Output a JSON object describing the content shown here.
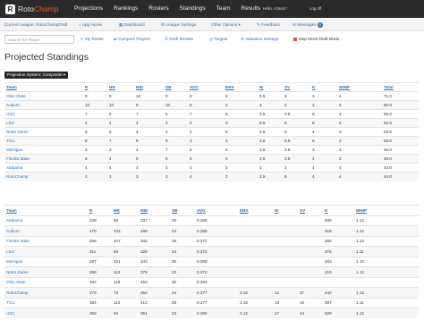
{
  "app": {
    "logo_letter": "R",
    "logo_roto": "Roto",
    "logo_champ": "Champ",
    "nav": [
      "Projections",
      "Rankings",
      "Rosters",
      "Standings",
      "Team",
      "Results"
    ],
    "user_greeting": "Hello, rclocal !",
    "logout_label": "Log off"
  },
  "subnav": {
    "current_league": "Current League: RotoChampDraft",
    "app_home": "App Home",
    "dashboard": "Dashboard",
    "league_settings": "League Settings",
    "other_options": "Other Options ▾",
    "feedback": "Feedback",
    "messages": "Messages",
    "messages_count": "0"
  },
  "actions": {
    "search_placeholder": "Search for Player",
    "my_roster": "My Roster",
    "compare_players": "Compare Players",
    "draft_results": "Draft Results",
    "targets": "Targets",
    "valuation_settings": "Valuation Settings",
    "stop_mock": "Stop Mock Draft Mode"
  },
  "page": {
    "title": "Projected Standings",
    "projection_system": "Projection System: Composite ▾"
  },
  "colors": {
    "topbar": "#2a2a2a",
    "brand_orange": "#e05a2a",
    "link_blue": "#2a6db0",
    "stop_red": "#d9534f"
  },
  "standings": {
    "headers": [
      "Team",
      "R",
      "HR",
      "RBI",
      "SB",
      "AVG",
      "ERA",
      "W",
      "SV",
      "K",
      "WHIP",
      "Total"
    ],
    "rows": [
      [
        "Ohio State",
        "9",
        "8",
        "10",
        "9",
        "8",
        "9",
        "5.5",
        "5",
        "3",
        "4",
        "71.0"
      ],
      [
        "Auburn",
        "10",
        "10",
        "9",
        "10",
        "9",
        "4",
        "4",
        "4",
        "3",
        "4",
        "60.0"
      ],
      [
        "USC",
        "7",
        "6",
        "7",
        "6",
        "7",
        "8",
        "3.5",
        "5.5",
        "8",
        "4",
        "55.0"
      ],
      [
        "LSU",
        "4",
        "4",
        "4",
        "4",
        "4",
        "3",
        "5.5",
        "8",
        "8",
        "2",
        "53.5"
      ],
      [
        "Notre Dame",
        "6",
        "5",
        "4",
        "3",
        "4",
        "5",
        "5.5",
        "9",
        "4",
        "3",
        "53.5"
      ],
      [
        "TCU",
        "8",
        "7",
        "8",
        "8",
        "3",
        "4",
        "3.5",
        "5.5",
        "6",
        "3",
        "53.0"
      ],
      [
        "Michigan",
        "3",
        "3",
        "4",
        "7",
        "6",
        "6",
        "3.5",
        "3.5",
        "3",
        "4",
        "46.0"
      ],
      [
        "Florida State",
        "5",
        "4",
        "5",
        "5",
        "6",
        "5",
        "3.5",
        "3.5",
        "4",
        "3",
        "46.0"
      ],
      [
        "Alabama",
        "4",
        "4",
        "4",
        "4",
        "4",
        "3",
        "3",
        "3",
        "4",
        "4",
        "44.0"
      ],
      [
        "RotoChamp",
        "2",
        "2",
        "3",
        "2",
        "4",
        "2",
        "3.5",
        "6",
        "4",
        "4",
        "44.0"
      ]
    ]
  },
  "stats": {
    "headers": [
      "Team",
      "R",
      "HR",
      "RBI",
      "SB",
      "AVG",
      "ERA",
      "W",
      "SV",
      "K",
      "WHIP"
    ],
    "rows": [
      [
        "Alabama",
        "239",
        "66",
        "237",
        "30",
        "0.285",
        "",
        "",
        "",
        "605",
        "1.12"
      ],
      [
        "Auburn",
        "470",
        "124",
        "486",
        "24",
        "0.289",
        "",
        "",
        "",
        "418",
        "1.12"
      ],
      [
        "Florida State",
        "256",
        "107",
        "343",
        "29",
        "0.272",
        "",
        "",
        "",
        "366",
        "1.14"
      ],
      [
        "LSU",
        "311",
        "94",
        "329",
        "24",
        "0.272",
        "",
        "",
        "",
        "376",
        "1.11"
      ],
      [
        "Michigan",
        "297",
        "101",
        "343",
        "25",
        "0.289",
        "",
        "",
        "",
        "483",
        "1.10"
      ],
      [
        "Notre Dame",
        "268",
        "113",
        "378",
        "23",
        "0.272",
        "",
        "",
        "",
        "416",
        "1.14"
      ],
      [
        "Ohio State",
        "462",
        "118",
        "453",
        "30",
        "0.283",
        "",
        "",
        "",
        "",
        ""
      ],
      [
        "RotoChamp",
        "279",
        "73",
        "252",
        "24",
        "0.277",
        "3.16",
        "12",
        "27",
        "442",
        "1.12"
      ],
      [
        "TCU",
        "384",
        "114",
        "413",
        "28",
        "0.277",
        "3.16",
        "18",
        "16",
        "397",
        "1.11"
      ],
      [
        "USC",
        "363",
        "94",
        "351",
        "23",
        "0.290",
        "3.12",
        "17",
        "14",
        "528",
        "1.12"
      ]
    ]
  }
}
